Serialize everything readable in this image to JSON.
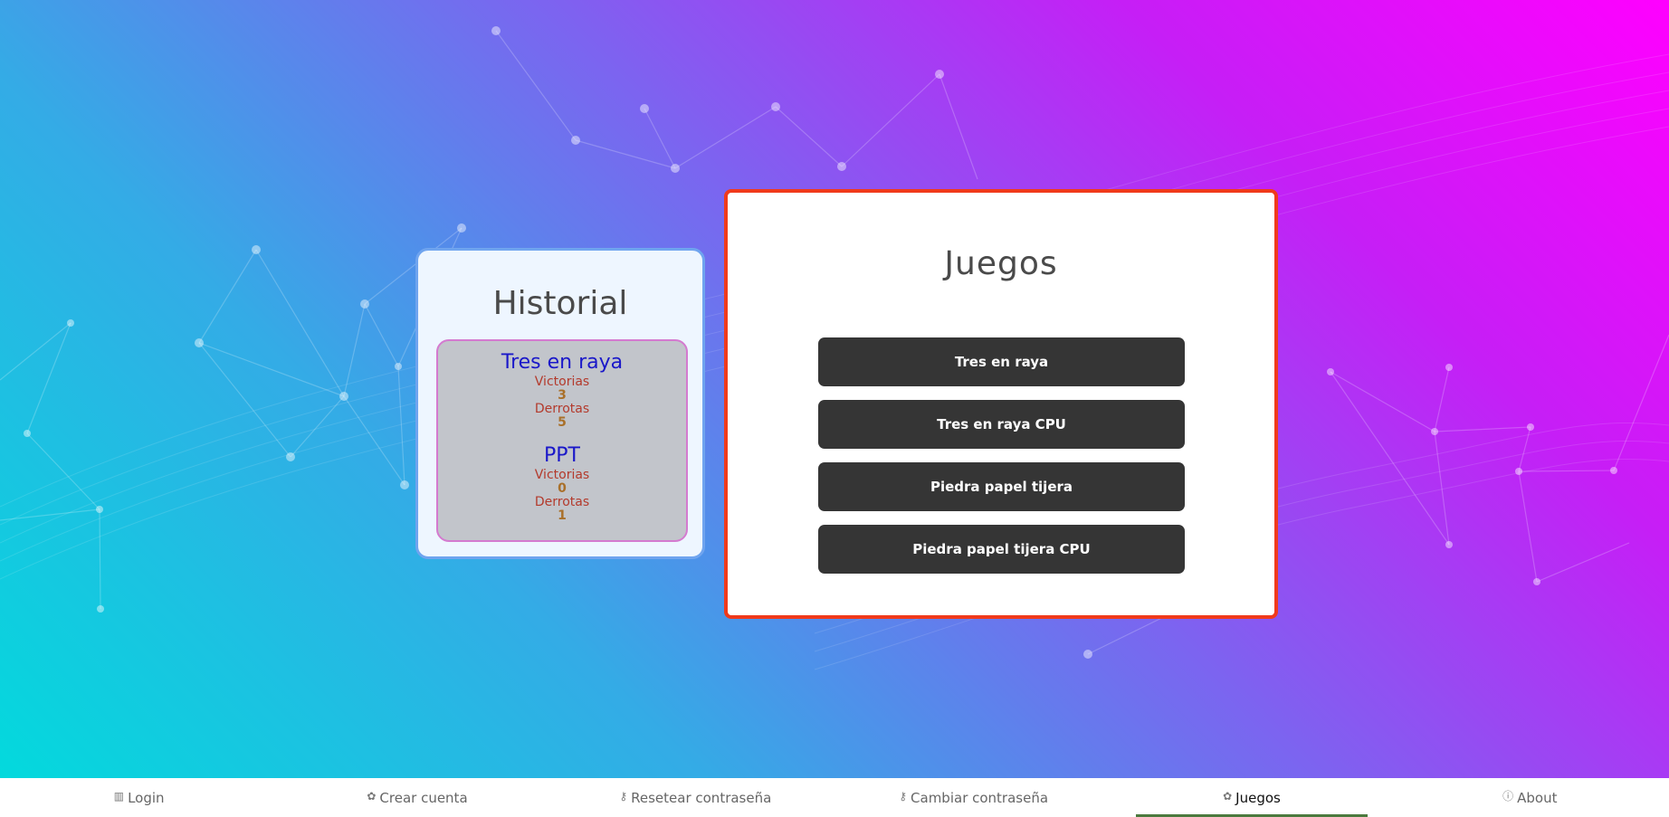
{
  "historial": {
    "title": "Historial",
    "games": [
      {
        "name": "Tres en raya",
        "wins_label": "Victorias",
        "wins": "3",
        "losses_label": "Derrotas",
        "losses": "5"
      },
      {
        "name": "PPT",
        "wins_label": "Victorias",
        "wins": "0",
        "losses_label": "Derrotas",
        "losses": "1"
      }
    ]
  },
  "juegos": {
    "title": "Juegos",
    "buttons": [
      "Tres en raya",
      "Tres en raya CPU",
      "Piedra papel tijera",
      "Piedra papel tijera CPU"
    ]
  },
  "nav": {
    "items": [
      {
        "label": "Login",
        "icon": "chart-icon",
        "glyph": "▥",
        "active": false
      },
      {
        "label": "Crear cuenta",
        "icon": "palette-icon",
        "glyph": "✿",
        "active": false
      },
      {
        "label": "Resetear contraseña",
        "icon": "key-icon",
        "glyph": "⚷",
        "active": false
      },
      {
        "label": "Cambiar contraseña",
        "icon": "key-icon",
        "glyph": "⚷",
        "active": false
      },
      {
        "label": "Juegos",
        "icon": "palette-icon",
        "glyph": "✿",
        "active": true
      },
      {
        "label": "About",
        "icon": "info-icon",
        "glyph": "ⓘ",
        "active": false
      }
    ]
  },
  "colors": {
    "card_border_historial": "#6fa4ef",
    "card_border_juegos": "#f03a1c",
    "button_bg": "#353535",
    "game_name": "#1a18c9",
    "stat_label": "#b33a2c",
    "nav_active_underline": "#4b7a3e"
  }
}
